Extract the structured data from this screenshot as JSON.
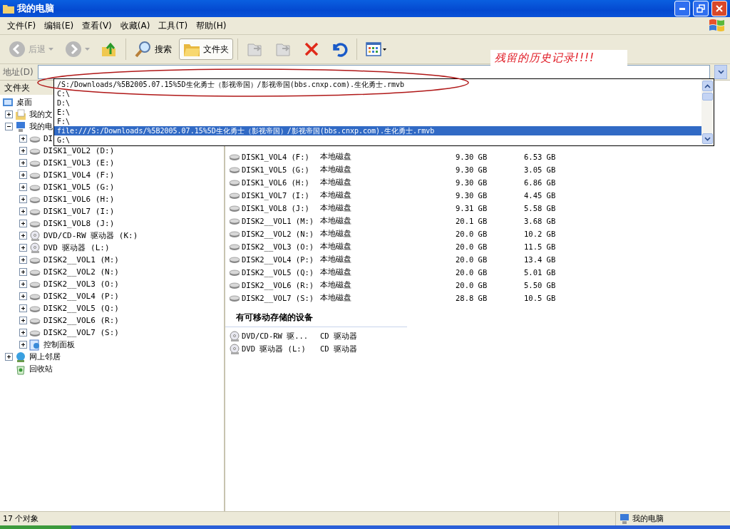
{
  "window": {
    "title": "我的电脑"
  },
  "menu": [
    "文件(F)",
    "编辑(E)",
    "查看(V)",
    "收藏(A)",
    "工具(T)",
    "帮助(H)"
  ],
  "toolbar": [
    {
      "kind": "back",
      "label": "后退",
      "disabled": true
    },
    {
      "kind": "forward",
      "disabled": true
    },
    {
      "kind": "up"
    },
    {
      "kind": "search",
      "label": "搜索"
    },
    {
      "kind": "folders",
      "label": "文件夹",
      "selected": true
    },
    {
      "kind": "move",
      "disabled": true
    },
    {
      "kind": "copy",
      "disabled": true
    },
    {
      "kind": "delete"
    },
    {
      "kind": "undo"
    },
    {
      "kind": "views"
    }
  ],
  "address": {
    "label": "地址(D)"
  },
  "address_history": [
    {
      "text": "/S:/Downloads/%5B2005.07.15%5D生化勇士（影视帝国）/影视帝国(bbs.cnxp.com).生化勇士.rmvb",
      "selected": false
    },
    {
      "text": "C:\\",
      "selected": false
    },
    {
      "text": "D:\\",
      "selected": false
    },
    {
      "text": "E:\\",
      "selected": false
    },
    {
      "text": "F:\\",
      "selected": false
    },
    {
      "text": "file:///S:/Downloads/%5B2005.07.15%5D生化勇士（影视帝国）/影视帝国(bbs.cnxp.com).生化勇士.rmvb",
      "selected": true
    },
    {
      "text": "G:\\",
      "selected": false
    }
  ],
  "annotation": "残留的历史记录!!!!",
  "folders_pane": {
    "title": "文件夹",
    "tree": [
      {
        "label": "桌面",
        "kind": "desktop",
        "children": [
          {
            "label": "我的文",
            "kind": "documents",
            "expanded": false
          },
          {
            "label": "我的电",
            "kind": "computer",
            "expanded": true,
            "children": [
              {
                "label": "DI",
                "kind": "drive",
                "expanded": false
              },
              {
                "label": "DISK1_VOL2 (D:)",
                "kind": "drive",
                "expanded": false
              },
              {
                "label": "DISK1_VOL3 (E:)",
                "kind": "drive",
                "expanded": false
              },
              {
                "label": "DISK1_VOL4 (F:)",
                "kind": "drive",
                "expanded": false
              },
              {
                "label": "DISK1_VOL5 (G:)",
                "kind": "drive",
                "expanded": false
              },
              {
                "label": "DISK1_VOL6 (H:)",
                "kind": "drive",
                "expanded": false
              },
              {
                "label": "DISK1_VOL7 (I:)",
                "kind": "drive",
                "expanded": false
              },
              {
                "label": "DISK1_VOL8 (J:)",
                "kind": "drive",
                "expanded": false
              },
              {
                "label": "DVD/CD-RW 驱动器 (K:)",
                "kind": "cd",
                "expanded": false
              },
              {
                "label": "DVD 驱动器 (L:)",
                "kind": "cd",
                "expanded": false
              },
              {
                "label": "DISK2__VOL1 (M:)",
                "kind": "drive",
                "expanded": false
              },
              {
                "label": "DISK2__VOL2 (N:)",
                "kind": "drive",
                "expanded": false
              },
              {
                "label": "DISK2__VOL3 (O:)",
                "kind": "drive",
                "expanded": false
              },
              {
                "label": "DISK2__VOL4 (P:)",
                "kind": "drive",
                "expanded": false
              },
              {
                "label": "DISK2__VOL5 (Q:)",
                "kind": "drive",
                "expanded": false
              },
              {
                "label": "DISK2__VOL6 (R:)",
                "kind": "drive",
                "expanded": false
              },
              {
                "label": "DISK2__VOL7 (S:)",
                "kind": "drive",
                "expanded": false
              },
              {
                "label": "控制面板",
                "kind": "control",
                "expanded": false
              }
            ]
          },
          {
            "label": "网上邻居",
            "kind": "network",
            "expanded": false
          },
          {
            "label": "回收站",
            "kind": "recycle"
          }
        ]
      }
    ]
  },
  "drives": [
    {
      "name": "DISK1_VOL4 (F:)",
      "type": "本地磁盘",
      "total": "9.30 GB",
      "free": "6.53 GB"
    },
    {
      "name": "DISK1_VOL5 (G:)",
      "type": "本地磁盘",
      "total": "9.30 GB",
      "free": "3.05 GB"
    },
    {
      "name": "DISK1_VOL6 (H:)",
      "type": "本地磁盘",
      "total": "9.30 GB",
      "free": "6.86 GB"
    },
    {
      "name": "DISK1_VOL7 (I:)",
      "type": "本地磁盘",
      "total": "9.30 GB",
      "free": "4.45 GB"
    },
    {
      "name": "DISK1_VOL8 (J:)",
      "type": "本地磁盘",
      "total": "9.31 GB",
      "free": "5.58 GB"
    },
    {
      "name": "DISK2__VOL1 (M:)",
      "type": "本地磁盘",
      "total": "20.1 GB",
      "free": "3.68 GB"
    },
    {
      "name": "DISK2__VOL2 (N:)",
      "type": "本地磁盘",
      "total": "20.0 GB",
      "free": "10.2 GB"
    },
    {
      "name": "DISK2__VOL3 (O:)",
      "type": "本地磁盘",
      "total": "20.0 GB",
      "free": "11.5 GB"
    },
    {
      "name": "DISK2__VOL4 (P:)",
      "type": "本地磁盘",
      "total": "20.0 GB",
      "free": "13.4 GB"
    },
    {
      "name": "DISK2__VOL5 (Q:)",
      "type": "本地磁盘",
      "total": "20.0 GB",
      "free": "5.01 GB"
    },
    {
      "name": "DISK2__VOL6 (R:)",
      "type": "本地磁盘",
      "total": "20.0 GB",
      "free": "5.50 GB"
    },
    {
      "name": "DISK2__VOL7 (S:)",
      "type": "本地磁盘",
      "total": "28.8 GB",
      "free": "10.5 GB"
    }
  ],
  "removable": {
    "title": "有可移动存储的设备",
    "items": [
      {
        "name": "DVD/CD-RW 驱...",
        "type": "CD 驱动器"
      },
      {
        "name": "DVD 驱动器 (L:)",
        "type": "CD 驱动器"
      }
    ]
  },
  "status_bar": {
    "count": "17 个对象",
    "location": "我的电脑"
  }
}
